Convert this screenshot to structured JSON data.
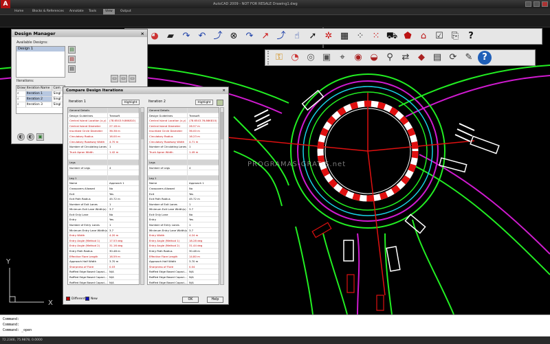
{
  "app": {
    "title": "AutoCAD 2009 - NOT FOR RESALE  Drawing1.dwg",
    "ribbon_tabs": [
      {
        "label": "Home"
      },
      {
        "label": "Blocks & References"
      },
      {
        "label": "Annotate"
      },
      {
        "label": "Tools"
      },
      {
        "label": "View",
        "active": true
      },
      {
        "label": "Output"
      }
    ]
  },
  "colors": {
    "canvas_bg": "#000000",
    "road_green": "#22ee22",
    "road_magenta": "#d01ad0",
    "road_cyan": "#19d4e6",
    "island_red": "#e01010",
    "island_white": "#ffffff",
    "axis_red": "#e01010",
    "diff_red": "#c00000",
    "new_blue": "#1010c0"
  },
  "toolbar_top": {
    "icons": [
      "wrench-search-icon",
      "color-wheel-icon",
      "truck-icon",
      "curve-arrow-1-icon",
      "curve-arrow-2-icon",
      "curve-arrow-3-icon",
      "close-circle-icon",
      "curve-arrow-4-icon",
      "curve-arrow-5-icon",
      "curve-arrow-6-icon",
      "hand-pointer-icon",
      "pointer-icon",
      "gear-link-icon",
      "grid-icon",
      "scatter-icon",
      "scatter-2-icon",
      "vehicle-icon",
      "shield-icon",
      "house-icon",
      "check-doc-icon",
      "preview-icon",
      "help-question-icon"
    ]
  },
  "toolbar_second": {
    "icons": [
      "key-icon",
      "palette-icon",
      "cd-icon",
      "box-3d-icon",
      "target-icon",
      "circle-dot-icon",
      "gauge-icon",
      "survey-icon",
      "transfer-icon",
      "diamond-icon",
      "calc-icon",
      "refresh-icon",
      "edit-doc-icon",
      "help-circle-icon"
    ]
  },
  "design_manager": {
    "title": "Design Manager",
    "available_label": "Available Designs:",
    "designs": [
      "Design 1"
    ],
    "iterations_label": "Iterations:",
    "columns": [
      "Draw",
      "Iteration Name",
      "Com"
    ],
    "rows": [
      {
        "name": "Iteration 1",
        "com": "Singl"
      },
      {
        "name": "Iteration 2",
        "com": "Singl"
      },
      {
        "name": "Iteration 3",
        "com": "Singl"
      }
    ]
  },
  "compare": {
    "title": "Compare Design Iterations",
    "left_title": "Iteration 1",
    "right_title": "Iteration 2",
    "highlight_label": "Highlight",
    "legend_different": "Different",
    "legend_new": "New",
    "ok_label": "OK",
    "help_label": "Help",
    "left_rows": [
      {
        "k": "General Details",
        "v": "",
        "t": "sec"
      },
      {
        "k": "Design Guidelines",
        "v": "Transoft",
        "t": ""
      },
      {
        "k": "Central Island Location (x,y)",
        "v": "(78.6543.9.86K810)",
        "t": "diff"
      },
      {
        "k": "Central Island Diameter",
        "v": "27.18 m",
        "t": "diff"
      },
      {
        "k": "Inscribed Circle Diameter",
        "v": "36.38 m",
        "t": "diff"
      },
      {
        "k": "Circulatory Radius",
        "v": "16.00 m",
        "t": "diff"
      },
      {
        "k": "Circulatory Roadway Width",
        "v": "4.70 m",
        "t": "diff"
      },
      {
        "k": "Number of Circulating Lanes",
        "v": "1",
        "t": ""
      },
      {
        "k": "Truck Apron Width",
        "v": "1.42 m",
        "t": "diff"
      },
      {
        "k": "",
        "v": "",
        "t": ""
      },
      {
        "k": "Legs",
        "v": "",
        "t": "sec"
      },
      {
        "k": "Number of Legs",
        "v": "4",
        "t": ""
      },
      {
        "k": "",
        "v": "",
        "t": ""
      },
      {
        "k": "Leg 1",
        "v": "",
        "t": "sec"
      },
      {
        "k": "Name",
        "v": "Approach 1",
        "t": ""
      },
      {
        "k": "Crossovers Allowed",
        "v": "No",
        "t": ""
      },
      {
        "k": "Exit",
        "v": "Yes",
        "t": ""
      },
      {
        "k": "Exit Path Radius",
        "v": "45.72 m",
        "t": ""
      },
      {
        "k": "Number of Exit Lanes",
        "v": "1",
        "t": ""
      },
      {
        "k": "Minimum Exit Lane Width(s)",
        "v": "3.7",
        "t": ""
      },
      {
        "k": "Exit Only Lane",
        "v": "No",
        "t": ""
      },
      {
        "k": "Entry",
        "v": "Yes",
        "t": ""
      },
      {
        "k": "Number of Entry Lanes",
        "v": "1",
        "t": ""
      },
      {
        "k": "Minimum Entry Lane Width(s)",
        "v": "3.7",
        "t": ""
      },
      {
        "k": "Entry Width",
        "v": "4.20 m",
        "t": "diff"
      },
      {
        "k": "Entry Angle (Method 1)",
        "v": "17.53 deg",
        "t": "diff"
      },
      {
        "k": "Entry Angle (Method 2)",
        "v": "31.16 deg",
        "t": "diff"
      },
      {
        "k": "Entry Path Radius",
        "v": "30.48 m",
        "t": ""
      },
      {
        "k": "Effective Flare Length",
        "v": "16.59 m",
        "t": "diff"
      },
      {
        "k": "Approach Half Width",
        "v": "3.70 m",
        "t": ""
      },
      {
        "k": "Sharpness of Flare",
        "v": "0.03",
        "t": "diff"
      },
      {
        "k": "Raffled Edge Based Capaci...",
        "v": "N/A",
        "t": ""
      },
      {
        "k": "Raffled Edge Based Capaci...",
        "v": "N/A",
        "t": ""
      },
      {
        "k": "Raffled Edge Based Capaci...",
        "v": "N/A",
        "t": ""
      }
    ],
    "right_rows": [
      {
        "k": "General Details",
        "v": "",
        "t": "sec"
      },
      {
        "k": "Design Guidelines",
        "v": "Transoft",
        "t": ""
      },
      {
        "k": "Central Island Location (x,y)",
        "v": "(78.6543.76.86K810)",
        "t": "diff"
      },
      {
        "k": "Central Island Diameter",
        "v": "26.57 m",
        "t": "diff"
      },
      {
        "k": "Inscribed Circle Diameter",
        "v": "36.00 m",
        "t": "diff"
      },
      {
        "k": "Circulatory Radius",
        "v": "16.23 m",
        "t": "diff"
      },
      {
        "k": "Circulatory Roadway Width",
        "v": "4.71 m",
        "t": "diff"
      },
      {
        "k": "Number of Circulating Lanes",
        "v": "1",
        "t": ""
      },
      {
        "k": "Truck Apron Width",
        "v": "1.49 m",
        "t": "diff"
      },
      {
        "k": "",
        "v": "",
        "t": ""
      },
      {
        "k": "Legs",
        "v": "",
        "t": "sec"
      },
      {
        "k": "Number of Legs",
        "v": "4",
        "t": ""
      },
      {
        "k": "",
        "v": "",
        "t": ""
      },
      {
        "k": "Leg 1",
        "v": "",
        "t": "sec"
      },
      {
        "k": "Name",
        "v": "Approach 1",
        "t": ""
      },
      {
        "k": "Crossovers Allowed",
        "v": "No",
        "t": ""
      },
      {
        "k": "Exit",
        "v": "Yes",
        "t": ""
      },
      {
        "k": "Exit Path Radius",
        "v": "45.72 m",
        "t": ""
      },
      {
        "k": "Number of Exit Lanes",
        "v": "1",
        "t": ""
      },
      {
        "k": "Minimum Exit Lane Width(s)",
        "v": "3.7",
        "t": ""
      },
      {
        "k": "Exit Only Lane",
        "v": "No",
        "t": ""
      },
      {
        "k": "Entry",
        "v": "Yes",
        "t": ""
      },
      {
        "k": "Number of Entry Lanes",
        "v": "1",
        "t": ""
      },
      {
        "k": "Minimum Entry Lane Width(s)",
        "v": "3.7",
        "t": ""
      },
      {
        "k": "Entry Width",
        "v": "4.24 m",
        "t": "diff"
      },
      {
        "k": "Entry Angle (Method 1)",
        "v": "18.28 deg",
        "t": "diff"
      },
      {
        "k": "Entry Angle (Method 2)",
        "v": "31.44 deg",
        "t": "diff"
      },
      {
        "k": "Entry Path Radius",
        "v": "30.48 m",
        "t": ""
      },
      {
        "k": "Effective Flare Length",
        "v": "14.80 m",
        "t": "diff"
      },
      {
        "k": "Approach Half Width",
        "v": "3.70 m",
        "t": ""
      },
      {
        "k": "Sharpness of Flare",
        "v": "0.04",
        "t": "diff"
      },
      {
        "k": "Raffled Edge Based Capaci...",
        "v": "N/A",
        "t": ""
      },
      {
        "k": "Raffled Edge Based Capaci...",
        "v": "N/A",
        "t": ""
      },
      {
        "k": "Raffled Edge Based Capaci...",
        "v": "N/A",
        "t": ""
      }
    ]
  },
  "ucs": {
    "y_label": "Y",
    "x_label": "X"
  },
  "watermark": "PROGRAMAS-GRATIS.net",
  "command_lines": [
    "Command:",
    "Command:",
    "Command: _open",
    "Command:"
  ],
  "status_coords": "72.2346, 75.9878, 0.0000"
}
